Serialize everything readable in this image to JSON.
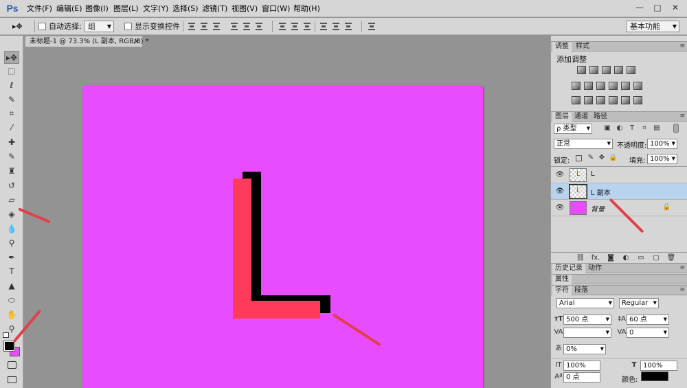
{
  "app": {
    "logo": "Ps"
  },
  "menu": [
    "文件(F)",
    "编辑(E)",
    "图像(I)",
    "图层(L)",
    "文字(Y)",
    "选择(S)",
    "滤镜(T)",
    "视图(V)",
    "窗口(W)",
    "帮助(H)"
  ],
  "window_buttons": [
    "—",
    "□",
    "✕"
  ],
  "options": {
    "auto_select_label": "自动选择:",
    "auto_select_value": "组",
    "show_transform_label": "显示变换控件",
    "workspace": "基本功能"
  },
  "document": {
    "tab_title": "未标题-1 @ 73.3% (L 副本, RGB/8) *",
    "close": "×",
    "canvas_color": "#e84cff",
    "letter_front_color": "#ff3a5a",
    "letter_shadow_color": "#000000"
  },
  "panels": {
    "adjust_tabs": [
      "调整",
      "样式"
    ],
    "adjust_title": "添加调整",
    "layers_tabs": [
      "图层",
      "通道",
      "路径"
    ],
    "kind_filter": "ρ 类型",
    "blend_mode": "正常",
    "opacity_label": "不透明度:",
    "opacity_value": "100%",
    "lock_label": "锁定:",
    "fill_label": "填充:",
    "fill_value": "100%",
    "layers": [
      {
        "name": "L",
        "thumb": "transparent",
        "selected": false
      },
      {
        "name": "L 副本",
        "thumb": "transparent",
        "selected": true
      },
      {
        "name": "背景",
        "thumb": "#e84cff",
        "selected": false
      }
    ],
    "history_tabs": [
      "历史记录",
      "动作"
    ],
    "properties_label": "属性",
    "char_tabs": [
      "字符",
      "段落"
    ],
    "font_family": "Arial",
    "font_style": "Regular",
    "font_size": "500 点",
    "leading": "60 点",
    "kerning": "",
    "tracking": "0",
    "baseline_pct": "0%",
    "vscale": "100%",
    "hscale": "100%",
    "baseline_shift": "0 点",
    "color_label": "颜色:",
    "color_value": "#000000"
  }
}
